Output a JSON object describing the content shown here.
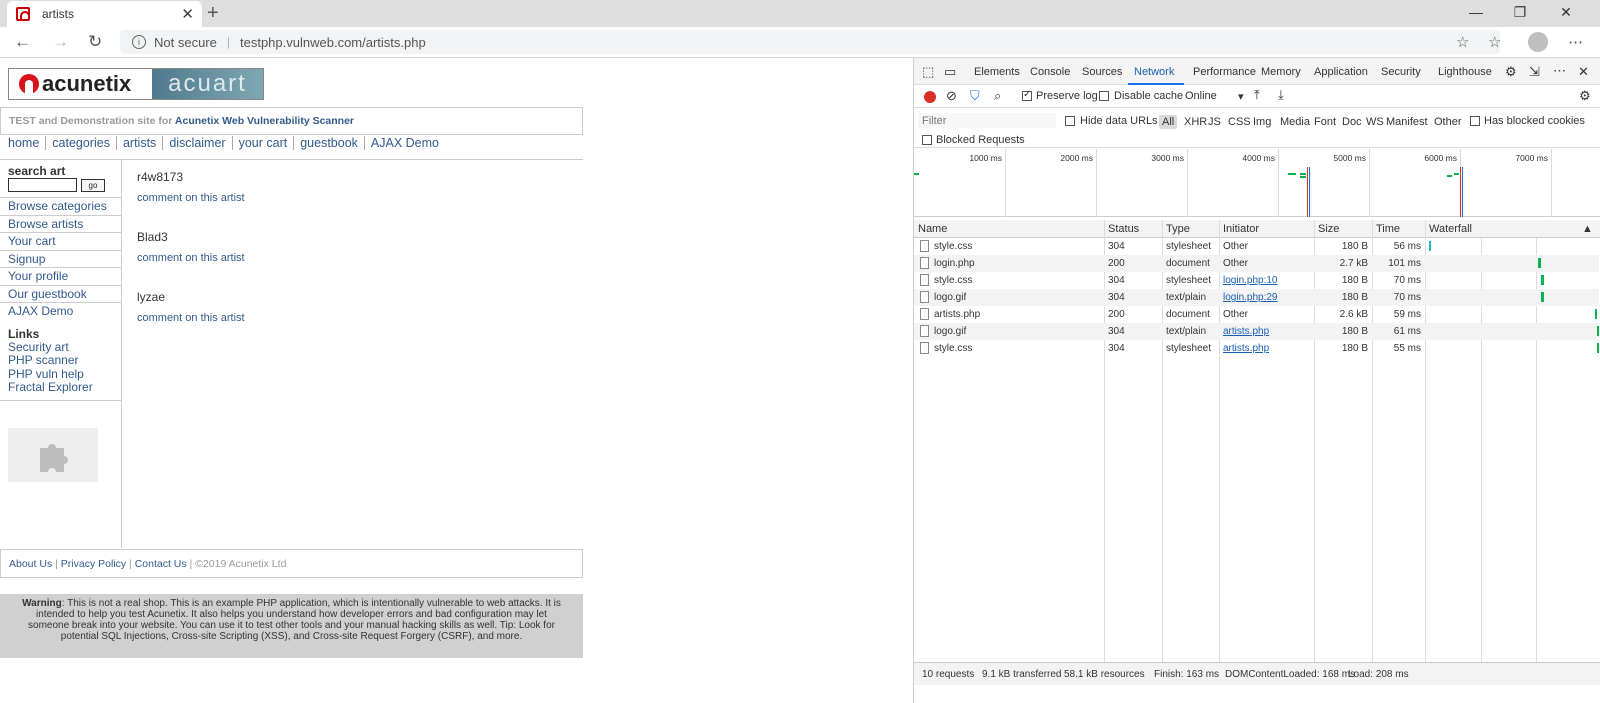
{
  "browser": {
    "tab_title": "artists",
    "new_tab": "+",
    "tab_close": "✕",
    "not_secure": "Not secure",
    "url": "testphp.vulnweb.com/artists.php",
    "window_controls": [
      "—",
      "❐",
      "✕"
    ]
  },
  "site": {
    "logo_left": "acunetix",
    "logo_right": "acuart",
    "tagline_prefix": "TEST and Demonstration site for ",
    "tagline_link": "Acunetix Web Vulnerability Scanner",
    "nav": [
      "home",
      "categories",
      "artists",
      "disclaimer",
      "your cart",
      "guestbook",
      "AJAX Demo"
    ],
    "search_label": "search art",
    "search_button": "go",
    "side_links": [
      "Browse categories",
      "Browse artists",
      "Your cart",
      "Signup",
      "Your profile",
      "Our guestbook",
      "AJAX Demo"
    ],
    "links_heading": "Links",
    "ext_links": [
      "Security art",
      "PHP scanner",
      "PHP vuln help",
      "Fractal Explorer"
    ],
    "artists": [
      {
        "name": "r4w8173",
        "comment": "comment on this artist"
      },
      {
        "name": "Blad3",
        "comment": "comment on this artist"
      },
      {
        "name": "lyzae",
        "comment": "comment on this artist"
      }
    ],
    "footer_links": [
      "About Us",
      "Privacy Policy",
      "Contact Us"
    ],
    "footer_copy": "©2019 Acunetix Ltd",
    "warning_label": "Warning",
    "warning_text": ": This is not a real shop. This is an example PHP application, which is intentionally vulnerable to web attacks. It is intended to help you test Acunetix. It also helps you understand how developer errors and bad configuration may let someone break into your website. You can use it to test other tools and your manual hacking skills as well. Tip: Look for potential SQL Injections, Cross-site Scripting (XSS), and Cross-site Request Forgery (CSRF), and more."
  },
  "devtools": {
    "tabs": [
      "Elements",
      "Console",
      "Sources",
      "Network",
      "Performance",
      "Memory",
      "Application",
      "Security",
      "Lighthouse"
    ],
    "active_tab": "Network",
    "preserve_log": "Preserve log",
    "disable_cache": "Disable cache",
    "throttle": "Online",
    "filter_placeholder": "Filter",
    "hide_data_urls": "Hide data URLs",
    "types": [
      "All",
      "XHR",
      "JS",
      "CSS",
      "Img",
      "Media",
      "Font",
      "Doc",
      "WS",
      "Manifest",
      "Other"
    ],
    "has_blocked_cookies": "Has blocked cookies",
    "blocked_requests": "Blocked Requests",
    "overview_labels": [
      "1000 ms",
      "2000 ms",
      "3000 ms",
      "4000 ms",
      "5000 ms",
      "6000 ms",
      "7000 ms"
    ],
    "columns": [
      "Name",
      "Status",
      "Type",
      "Initiator",
      "Size",
      "Time",
      "Waterfall"
    ],
    "rows": [
      {
        "name": "style.css",
        "status": "304",
        "type": "stylesheet",
        "initiator": "Other",
        "initiator_link": false,
        "size": "180 B",
        "time": "56 ms"
      },
      {
        "name": "login.php",
        "status": "200",
        "type": "document",
        "initiator": "Other",
        "initiator_link": false,
        "size": "2.7 kB",
        "time": "101 ms"
      },
      {
        "name": "style.css",
        "status": "304",
        "type": "stylesheet",
        "initiator": "login.php:10",
        "initiator_link": true,
        "size": "180 B",
        "time": "70 ms"
      },
      {
        "name": "logo.gif",
        "status": "304",
        "type": "text/plain",
        "initiator": "login.php:29",
        "initiator_link": true,
        "size": "180 B",
        "time": "70 ms"
      },
      {
        "name": "artists.php",
        "status": "200",
        "type": "document",
        "initiator": "Other",
        "initiator_link": false,
        "size": "2.6 kB",
        "time": "59 ms"
      },
      {
        "name": "logo.gif",
        "status": "304",
        "type": "text/plain",
        "initiator": "artists.php",
        "initiator_link": true,
        "size": "180 B",
        "time": "61 ms"
      },
      {
        "name": "style.css",
        "status": "304",
        "type": "stylesheet",
        "initiator": "artists.php",
        "initiator_link": true,
        "size": "180 B",
        "time": "55 ms"
      }
    ],
    "status_bar": {
      "requests": "10 requests",
      "transferred": "9.1 kB transferred",
      "resources": "58.1 kB resources",
      "finish": "Finish: 163 ms",
      "dcl": "DOMContentLoaded: 168 ms",
      "load": "Load: 208 ms"
    },
    "colors": {
      "accent": "#1a73e8",
      "record": "#d93025",
      "waterfall": "#0bb34c"
    }
  }
}
